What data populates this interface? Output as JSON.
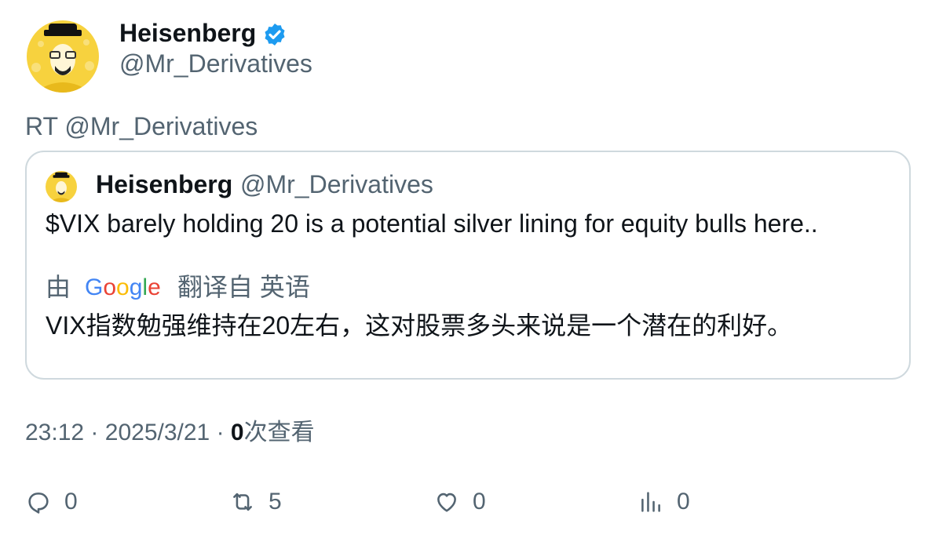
{
  "author": {
    "name": "Heisenberg",
    "handle": "@Mr_Derivatives",
    "verified_icon": "verified-badge-icon",
    "verified_color": "#1d9bf0"
  },
  "retweet_text": "RT @Mr_Derivatives",
  "quoted": {
    "name": "Heisenberg",
    "handle": "@Mr_Derivatives",
    "text": "$VIX barely holding 20 is a potential silver lining for equity bulls here..",
    "translate_by": "由",
    "translate_from": "翻译自 英语",
    "translation": "VIX指数勉强维持在20左右，这对股票多头来说是一个潜在的利好。"
  },
  "meta": {
    "time": "23:12",
    "separator": "·",
    "date": "2025/3/21",
    "views_count": "0",
    "views_label": "次查看"
  },
  "actions": {
    "reply_count": "0",
    "retweet_count": "5",
    "like_count": "0",
    "views_count": "0"
  },
  "colors": {
    "text_primary": "#0f1419",
    "text_secondary": "#536471",
    "border": "#cfd9de",
    "avatar_bg": "#f7d23e"
  }
}
